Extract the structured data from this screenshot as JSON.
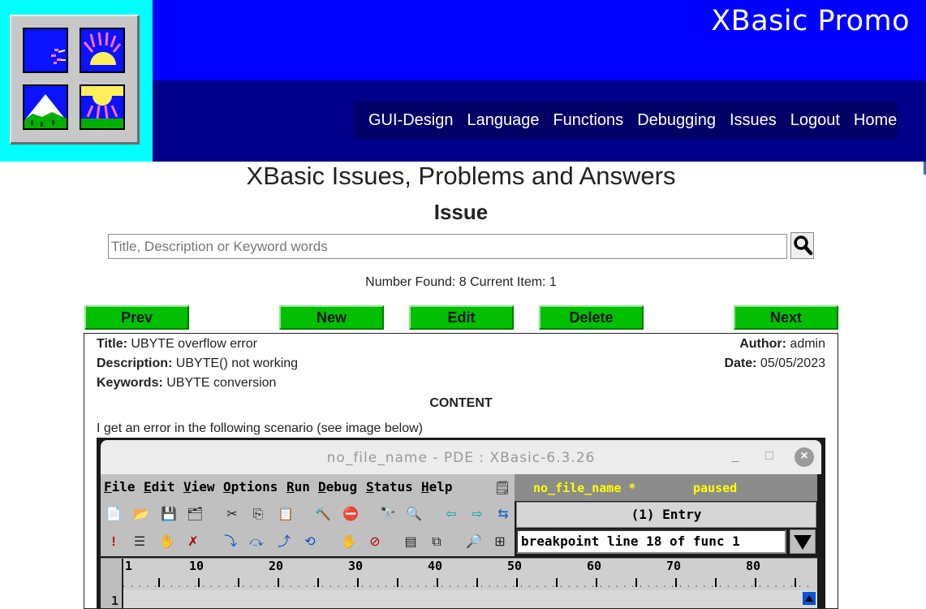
{
  "header": {
    "site_title": "XBasic Promo",
    "nav": [
      "GUI-Design",
      "Language",
      "Functions",
      "Debugging",
      "Issues",
      "Logout",
      "Home"
    ],
    "colors": {
      "logo_bg": "#00ffff",
      "banner_top": "#0000ff",
      "banner_bottom": "#00008b",
      "nav_bg": "#000066"
    }
  },
  "main": {
    "page_title": "XBasic Issues, Problems and Answers",
    "heading": "Issue",
    "search": {
      "placeholder": "Title, Description or Keyword words",
      "value": "",
      "icon": "magnifier-icon"
    },
    "count_text": "Number Found: 8 Current Item: 1",
    "buttons": {
      "prev": "Prev",
      "new": "New",
      "edit": "Edit",
      "delete": "Delete",
      "next": "Next",
      "color": "#00c000"
    },
    "issue": {
      "title_label": "Title:",
      "title": "UBYTE overflow error",
      "author_label": "Author:",
      "author": "admin",
      "description_label": "Description:",
      "description": "UBYTE() not working",
      "date_label": "Date:",
      "date": "05/05/2023",
      "keywords_label": "Keywords:",
      "keywords": "UBYTE conversion",
      "content_label": "CONTENT",
      "content_intro": "I get an error in the following scenario (see image below)"
    }
  },
  "screenshot": {
    "window_title": "no_file_name  -  PDE : XBasic-6.3.26",
    "window_controls": [
      "minimize-icon",
      "maximize-icon",
      "close-icon"
    ],
    "menu": [
      "File",
      "Edit",
      "View",
      "Options",
      "Run",
      "Debug",
      "Status",
      "Help"
    ],
    "status_file": "no_file_name *",
    "status_state": "paused",
    "entry": "(1) Entry",
    "breakpoint": "breakpoint line 18 of func 1",
    "ruler": [
      "1",
      "10",
      "20",
      "30",
      "40",
      "50",
      "60",
      "70",
      "80"
    ],
    "line_number": "1"
  }
}
